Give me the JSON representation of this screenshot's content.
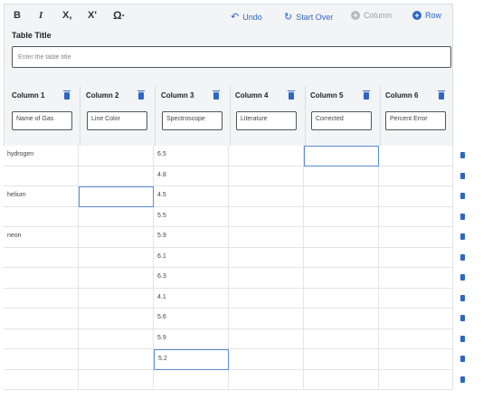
{
  "toolbar": {
    "bold": "B",
    "italic": "I",
    "subscript": "X,",
    "superscript": "X'",
    "special_char": "Ω·",
    "undo": "Undo",
    "start_over": "Start Over",
    "add_column": "Column",
    "add_row": "Row",
    "add_column_icon": "+",
    "add_row_icon": "+"
  },
  "table_title": {
    "label": "Table Title",
    "placeholder": "Enter the table title",
    "value": ""
  },
  "columns": [
    {
      "header": "Column 1",
      "value": "Name of Gas"
    },
    {
      "header": "Column 2",
      "value": "Line Color"
    },
    {
      "header": "Column 3",
      "value": "Spectroscope"
    },
    {
      "header": "Column 4",
      "value": "Literature"
    },
    {
      "header": "Column 5",
      "value": "Corrected"
    },
    {
      "header": "Column 6",
      "value": "Percent Error"
    }
  ],
  "rows": [
    [
      "hydrogen",
      "",
      "6.5",
      "",
      "",
      ""
    ],
    [
      "",
      "",
      "4.8",
      "",
      "",
      ""
    ],
    [
      "helium",
      "",
      "4.5",
      "",
      "",
      ""
    ],
    [
      "",
      "",
      "5.5",
      "",
      "",
      ""
    ],
    [
      "neon",
      "",
      "5.9",
      "",
      "",
      ""
    ],
    [
      "",
      "",
      "6.1",
      "",
      "",
      ""
    ],
    [
      "",
      "",
      "6.3",
      "",
      "",
      ""
    ],
    [
      "",
      "",
      "4.1",
      "",
      "",
      ""
    ],
    [
      "",
      "",
      "5.6",
      "",
      "",
      ""
    ],
    [
      "",
      "",
      "5.9",
      "",
      "",
      ""
    ],
    [
      "",
      "",
      "5.2",
      "",
      "",
      ""
    ],
    [
      "",
      "",
      "",
      "",
      "",
      ""
    ]
  ],
  "colors": {
    "accent": "#2e66c6",
    "focus_border": "#5b8bd6",
    "panel_bg": "#f3f4f6"
  }
}
